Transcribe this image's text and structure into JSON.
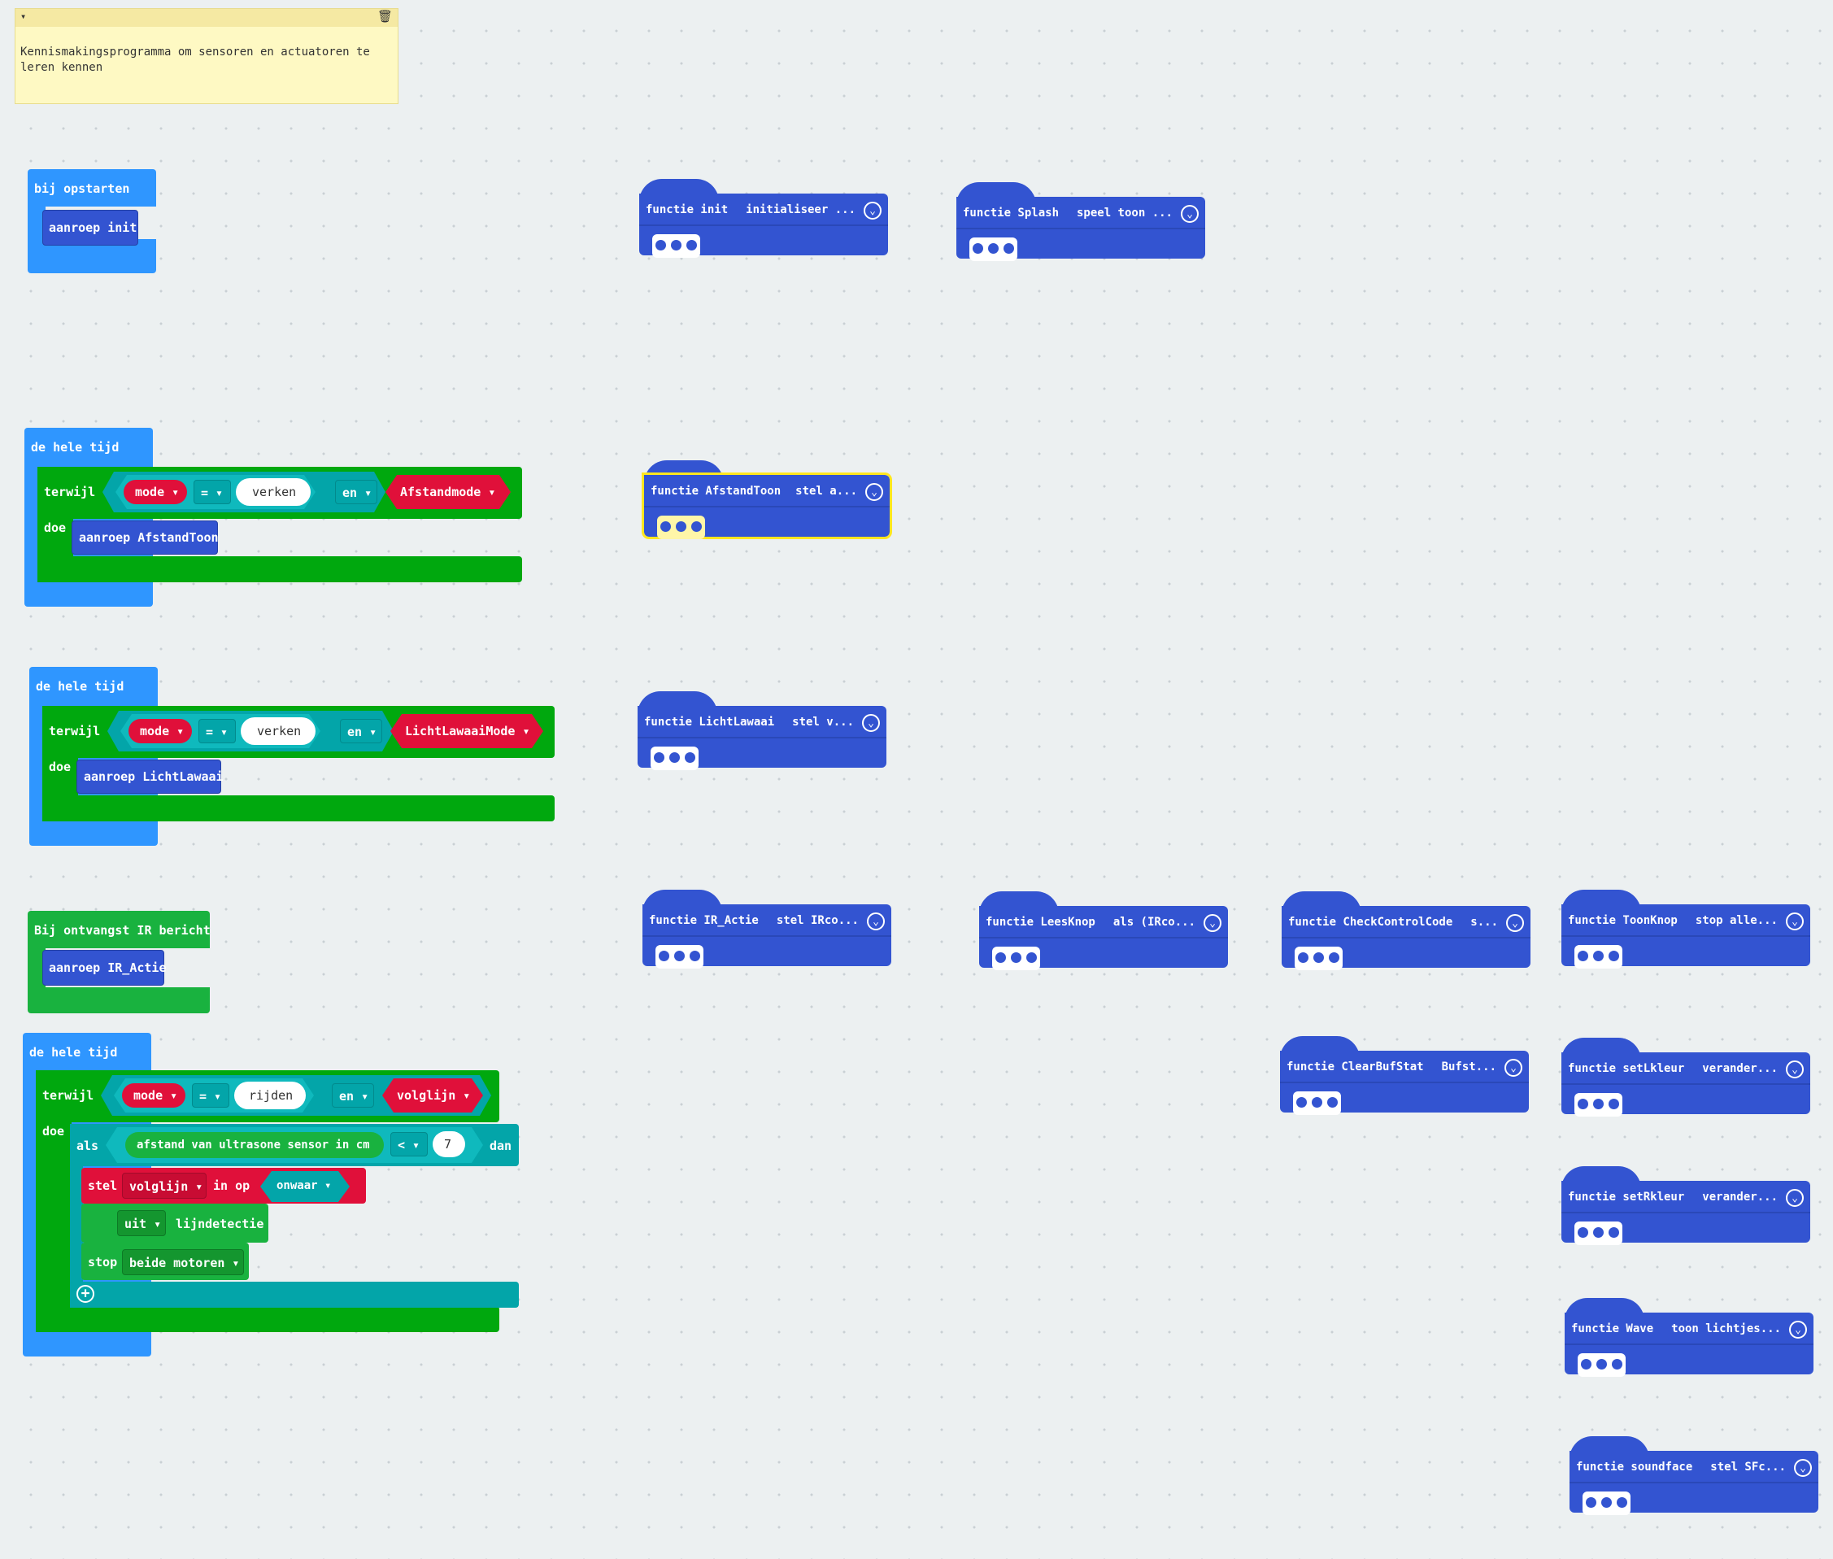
{
  "comment": {
    "text": "Kennismakingsprogramma om sensoren en actuatoren te leren kennen"
  },
  "on_start": {
    "header": "bij opstarten",
    "call": "aanroep init"
  },
  "forever1": {
    "header": "de hele tijd",
    "while": "terwijl",
    "do": "doe",
    "mode": "mode",
    "op": "=",
    "str": "verken",
    "and": "en",
    "var": "Afstandmode",
    "call": "aanroep AfstandToon"
  },
  "forever2": {
    "header": "de hele tijd",
    "while": "terwijl",
    "do": "doe",
    "mode": "mode",
    "op": "=",
    "str": "verken",
    "and": "en",
    "var": "LichtLawaaiMode",
    "call": "aanroep LichtLawaai"
  },
  "ir_event": {
    "header": "Bij ontvangst IR bericht",
    "call": "aanroep IR_Actie"
  },
  "forever3": {
    "header": "de hele tijd",
    "while": "terwijl",
    "do": "doe",
    "mode": "mode",
    "op": "=",
    "str": "rijden",
    "and": "en",
    "var": "volglijn",
    "if": "als",
    "sensor": "afstand van ultrasone sensor in cm",
    "cmp": "<",
    "num": "7",
    "then": "dan",
    "set": "stel",
    "set_var": "volglijn",
    "set_in": "in op",
    "set_val": "onwaar",
    "led_state": "uit",
    "led_label": "lijndetectie",
    "stop": "stop",
    "stop_target": "beide motoren"
  },
  "functions": [
    {
      "name": "functie init",
      "summary": "initialiseer ..."
    },
    {
      "name": "functie Splash",
      "summary": "speel toon ..."
    },
    {
      "name": "functie AfstandToon",
      "summary": "stel a..."
    },
    {
      "name": "functie LichtLawaai",
      "summary": "stel v..."
    },
    {
      "name": "functie IR_Actie",
      "summary": "stel IRco..."
    },
    {
      "name": "functie LeesKnop",
      "summary": "als (IRco..."
    },
    {
      "name": "functie CheckControlCode",
      "summary": "s..."
    },
    {
      "name": "functie ToonKnop",
      "summary": "stop alle..."
    },
    {
      "name": "functie ClearBufStat",
      "summary": "Bufst..."
    },
    {
      "name": "functie setLkleur",
      "summary": "verander..."
    },
    {
      "name": "functie setRkleur",
      "summary": "verander..."
    },
    {
      "name": "functie Wave",
      "summary": "toon lichtjes..."
    },
    {
      "name": "functie soundface",
      "summary": "stel SFc..."
    }
  ],
  "colors": {
    "event": "#2f96ff",
    "loop": "#00a80e",
    "logic": "#03a5a9",
    "variable": "#e0103a",
    "function": "#3354d1",
    "comment": "#fef9c3",
    "selected": "#ffe61f"
  }
}
